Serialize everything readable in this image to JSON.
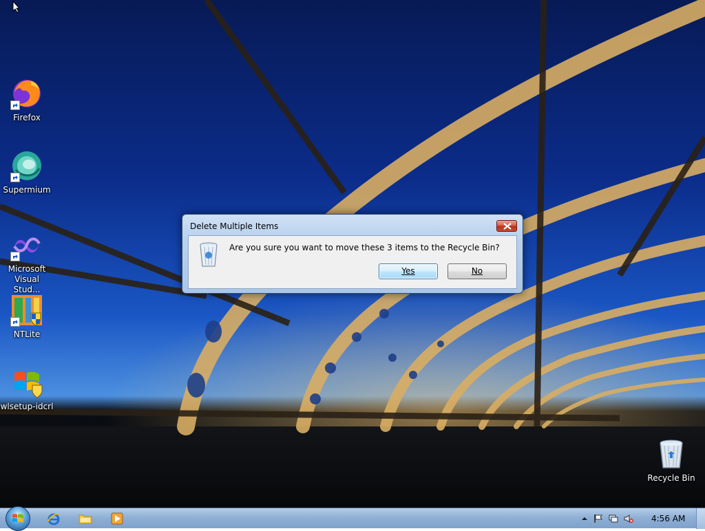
{
  "desktop": {
    "icons": [
      {
        "label": "Firefox",
        "icon": "firefox-icon"
      },
      {
        "label": "Supermium",
        "icon": "supermium-icon"
      },
      {
        "label": "Microsoft Visual Stud...",
        "icon": "visual-studio-icon"
      },
      {
        "label": "NTLite",
        "icon": "ntlite-icon"
      },
      {
        "label": "wlsetup-idcrl",
        "icon": "windows-installer-icon"
      },
      {
        "label": "Recycle Bin",
        "icon": "recycle-bin-icon"
      }
    ]
  },
  "dialog": {
    "title": "Delete Multiple Items",
    "message": "Are you sure you want to move these 3 items to the Recycle Bin?",
    "yes_label": "Yes",
    "no_label": "No"
  },
  "taskbar": {
    "pinned": [
      {
        "icon": "internet-explorer-icon"
      },
      {
        "icon": "file-explorer-icon"
      },
      {
        "icon": "media-player-icon"
      }
    ],
    "clock": "4:56 AM"
  },
  "colors": {
    "close_button": "#c94a2f",
    "taskbar": "#8fb0d6",
    "dialog_frame": "#aac6e8"
  }
}
